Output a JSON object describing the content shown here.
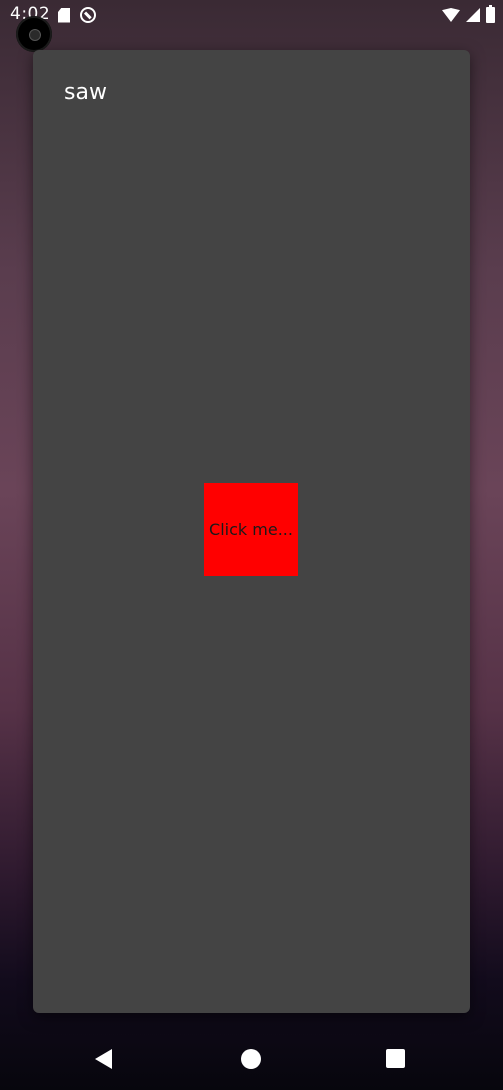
{
  "status_bar": {
    "time": "4:02",
    "icons_left": [
      "sd-card-icon",
      "do-not-disturb-icon"
    ],
    "icons_right": [
      "wifi-icon",
      "cell-signal-icon",
      "battery-icon"
    ]
  },
  "dialog": {
    "title": "saw",
    "button_label": "Click me...",
    "background_color": "#444444",
    "button_color": "#ff0000"
  },
  "nav_bar": {
    "buttons": [
      "back-icon",
      "home-icon",
      "recents-icon"
    ]
  }
}
